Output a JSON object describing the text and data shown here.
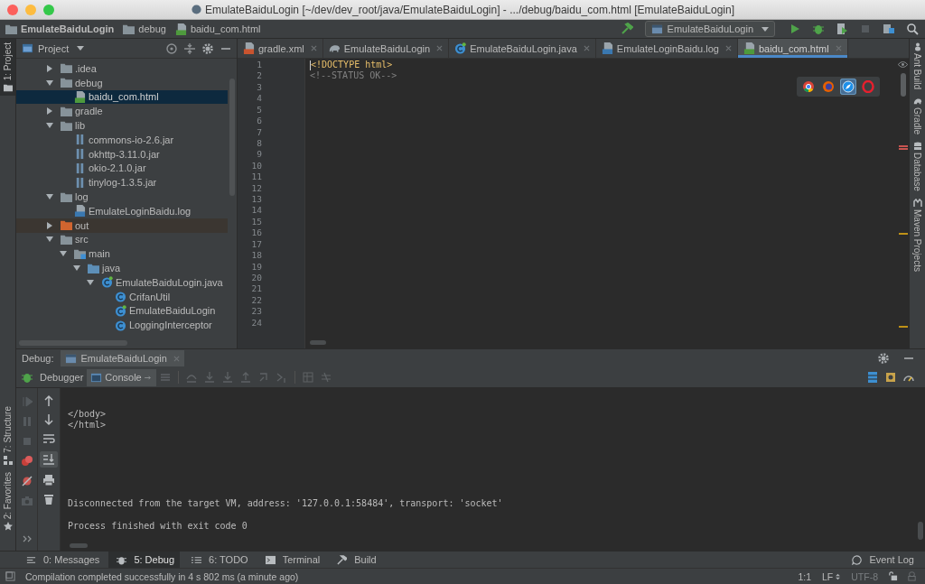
{
  "window": {
    "title": "EmulateBaiduLogin [~/dev/dev_root/java/EmulateBaiduLogin] - .../debug/baidu_com.html [EmulateBaiduLogin]"
  },
  "breadcrumbs": [
    {
      "label": "EmulateBaiduLogin",
      "kind": "project"
    },
    {
      "label": "debug",
      "kind": "folder"
    },
    {
      "label": "baidu_com.html",
      "kind": "html"
    }
  ],
  "run_config": {
    "label": "EmulateBaiduLogin"
  },
  "left_stripe": [
    {
      "label": "1: Project",
      "kind": "project",
      "selected": true
    },
    {
      "label": "7: Structure",
      "kind": "structure",
      "selected": false
    },
    {
      "label": "2: Favorites",
      "kind": "favorites",
      "selected": false
    }
  ],
  "project_panel": {
    "title": "Project",
    "tree": [
      {
        "label": ".idea",
        "kind": "folder",
        "expanded": false,
        "selected": false
      },
      {
        "label": "debug",
        "kind": "folder",
        "expanded": true,
        "selected": false,
        "children": [
          {
            "label": "baidu_com.html",
            "kind": "html",
            "selected": true
          }
        ]
      },
      {
        "label": "gradle",
        "kind": "folder",
        "expanded": false,
        "selected": false
      },
      {
        "label": "lib",
        "kind": "folder",
        "expanded": true,
        "selected": false,
        "children": [
          {
            "label": "commons-io-2.6.jar",
            "kind": "jar",
            "selected": false
          },
          {
            "label": "okhttp-3.11.0.jar",
            "kind": "jar",
            "selected": false
          },
          {
            "label": "okio-2.1.0.jar",
            "kind": "jar",
            "selected": false
          },
          {
            "label": "tinylog-1.3.5.jar",
            "kind": "jar",
            "selected": false
          }
        ]
      },
      {
        "label": "log",
        "kind": "folder",
        "expanded": true,
        "selected": false,
        "children": [
          {
            "label": "EmulateLoginBaidu.log",
            "kind": "log",
            "selected": false
          }
        ]
      },
      {
        "label": "out",
        "kind": "excluded-folder",
        "expanded": false,
        "selected": false
      },
      {
        "label": "src",
        "kind": "folder",
        "expanded": true,
        "selected": false,
        "children": [
          {
            "label": "main",
            "kind": "module-folder",
            "expanded": true,
            "selected": false,
            "children": [
              {
                "label": "java",
                "kind": "source-folder",
                "expanded": true,
                "selected": false,
                "children": [
                  {
                    "label": "EmulateBaiduLogin.java",
                    "kind": "java",
                    "expanded": true,
                    "selected": false,
                    "children": [
                      {
                        "label": "CrifanUtil",
                        "kind": "class",
                        "selected": false
                      },
                      {
                        "label": "EmulateBaiduLogin",
                        "kind": "main-class",
                        "selected": false
                      },
                      {
                        "label": "LoggingInterceptor",
                        "kind": "class",
                        "selected": false
                      }
                    ]
                  }
                ]
              }
            ]
          }
        ]
      }
    ]
  },
  "editor": {
    "tabs": [
      {
        "label": "gradle.xml",
        "kind": "xml",
        "selected": false
      },
      {
        "label": "EmulateBaiduLogin",
        "kind": "gradle",
        "selected": false
      },
      {
        "label": "EmulateBaiduLogin.java",
        "kind": "java",
        "selected": false
      },
      {
        "label": "EmulateLoginBaidu.log",
        "kind": "log",
        "selected": false
      },
      {
        "label": "baidu_com.html",
        "kind": "html",
        "selected": true
      }
    ],
    "lines": [
      {
        "number": "1",
        "text": "<!DOCTYPE html>",
        "kind": "doctype"
      },
      {
        "number": "2",
        "text": "<!--STATUS OK-->",
        "kind": "comment"
      },
      {
        "number": "3"
      },
      {
        "number": "4"
      },
      {
        "number": "5"
      },
      {
        "number": "6"
      },
      {
        "number": "7"
      },
      {
        "number": "8"
      },
      {
        "number": "9"
      },
      {
        "number": "10"
      },
      {
        "number": "11"
      },
      {
        "number": "12"
      },
      {
        "number": "13"
      },
      {
        "number": "14"
      },
      {
        "number": "15"
      },
      {
        "number": "16"
      },
      {
        "number": "17"
      },
      {
        "number": "18"
      },
      {
        "number": "19"
      },
      {
        "number": "20"
      },
      {
        "number": "21"
      },
      {
        "number": "22"
      },
      {
        "number": "23"
      },
      {
        "number": "24"
      }
    ],
    "browsers": [
      {
        "kind": "chrome",
        "selected": false
      },
      {
        "kind": "firefox",
        "selected": false
      },
      {
        "kind": "safari",
        "selected": true
      },
      {
        "kind": "opera",
        "selected": false
      }
    ]
  },
  "right_stripe": [
    {
      "label": "Ant Build",
      "kind": "ant"
    },
    {
      "label": "Gradle",
      "kind": "gradle"
    },
    {
      "label": "Database",
      "kind": "database"
    },
    {
      "label": "Maven Projects",
      "kind": "maven"
    }
  ],
  "debug": {
    "title": "Debug:",
    "session": {
      "label": "EmulateBaiduLogin"
    },
    "tabs": [
      {
        "label": "Debugger",
        "selected": false
      },
      {
        "label": "Console",
        "selected": true
      }
    ],
    "console_lines": [
      "</body>",
      "</html>",
      "Disconnected from the target VM, address: '127.0.0.1:58484', transport: 'socket'",
      "Process finished with exit code 0"
    ]
  },
  "tool_windows": [
    {
      "label": "0: Messages",
      "kind": "messages",
      "selected": false
    },
    {
      "label": "5: Debug",
      "kind": "debug",
      "selected": true
    },
    {
      "label": "6: TODO",
      "kind": "todo",
      "selected": false
    },
    {
      "label": "Terminal",
      "kind": "terminal",
      "selected": false
    },
    {
      "label": "Build",
      "kind": "build",
      "selected": false
    }
  ],
  "event_log": {
    "label": "Event Log"
  },
  "status_bar": {
    "message": "Compilation completed successfully in 4 s 802 ms (a minute ago)",
    "position": "1:1",
    "line_separator": "LF",
    "encoding": "UTF-8"
  }
}
